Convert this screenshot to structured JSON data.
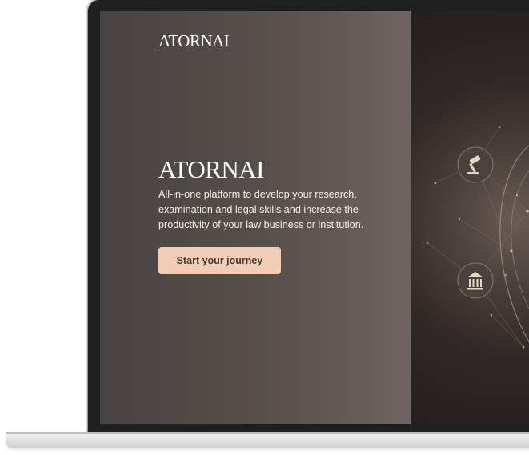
{
  "header": {
    "logo_text": "ATORNAI"
  },
  "hero": {
    "title": "ATORNAI",
    "subtitle": "All-in-one platform to develop your research, examination and legal skills and increase the productivity of your law business or institution.",
    "cta_label": "Start your journey"
  },
  "icons": {
    "top": "gavel-icon",
    "bottom": "courthouse-icon"
  },
  "colors": {
    "panel_left": "#484341",
    "panel_right": "#6f6461",
    "cta_background": "#f2cdb6",
    "cta_text": "#4a3a34",
    "visual_glow": "#6a5c55"
  }
}
